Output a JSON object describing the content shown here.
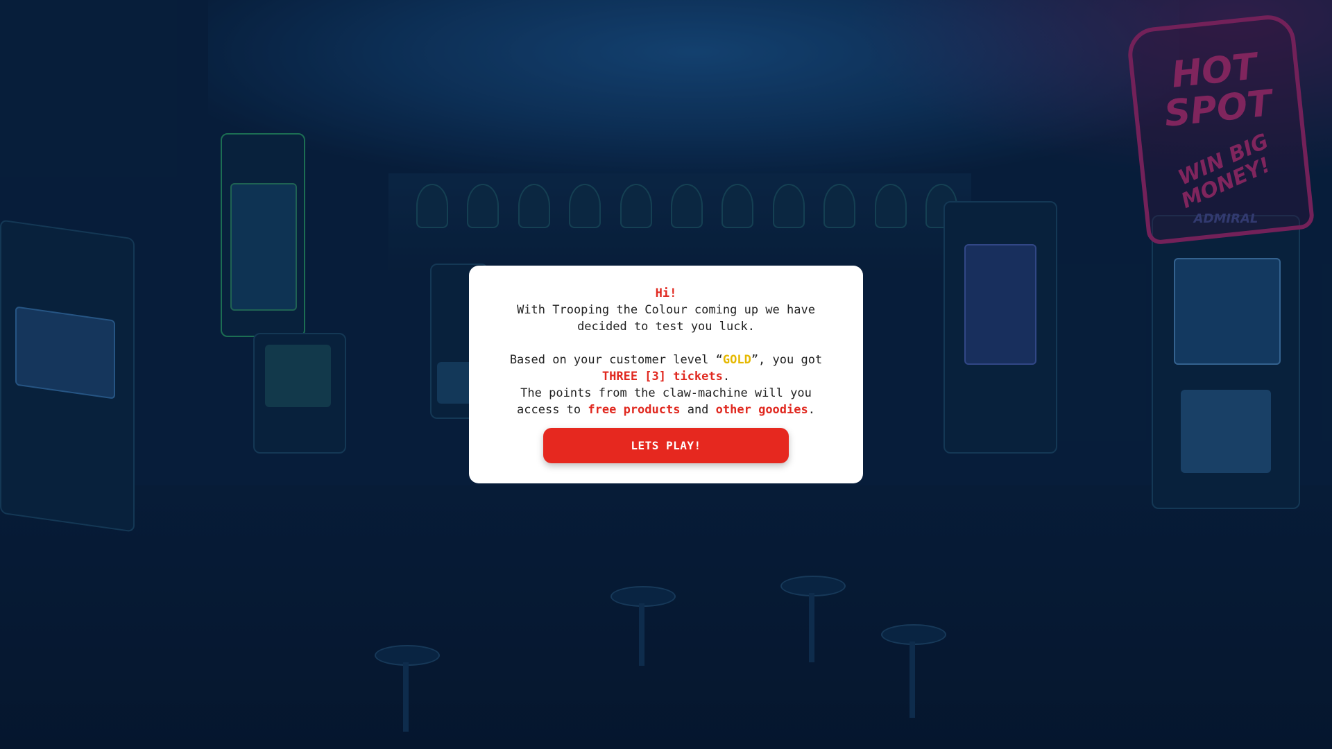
{
  "background": {
    "sign_line1": "HOT",
    "sign_line2": "SPOT",
    "sign_line3": "WIN BIG",
    "sign_line4": "MONEY!",
    "cabinet_brand": "ADMIRAL",
    "sign_color": "#c4307a",
    "base_color": "#0a2444"
  },
  "modal": {
    "greeting": "Hi!",
    "intro": "With Trooping the Colour coming up we have decided to test you luck.",
    "level_prefix": "Based on your customer level “",
    "level_value": "GOLD",
    "level_suffix": "”, you got",
    "tickets": "THREE [3] tickets",
    "tickets_period": ".",
    "points_text": "The points from the claw-machine will you access to",
    "free_products": "free products",
    "and_text": "and",
    "other_goodies": "other goodies",
    "end_period": ".",
    "play_button": "LETS PLAY!"
  },
  "colors": {
    "accent_red": "#e6281f",
    "gold": "#e5b800",
    "modal_bg": "#ffffff"
  }
}
